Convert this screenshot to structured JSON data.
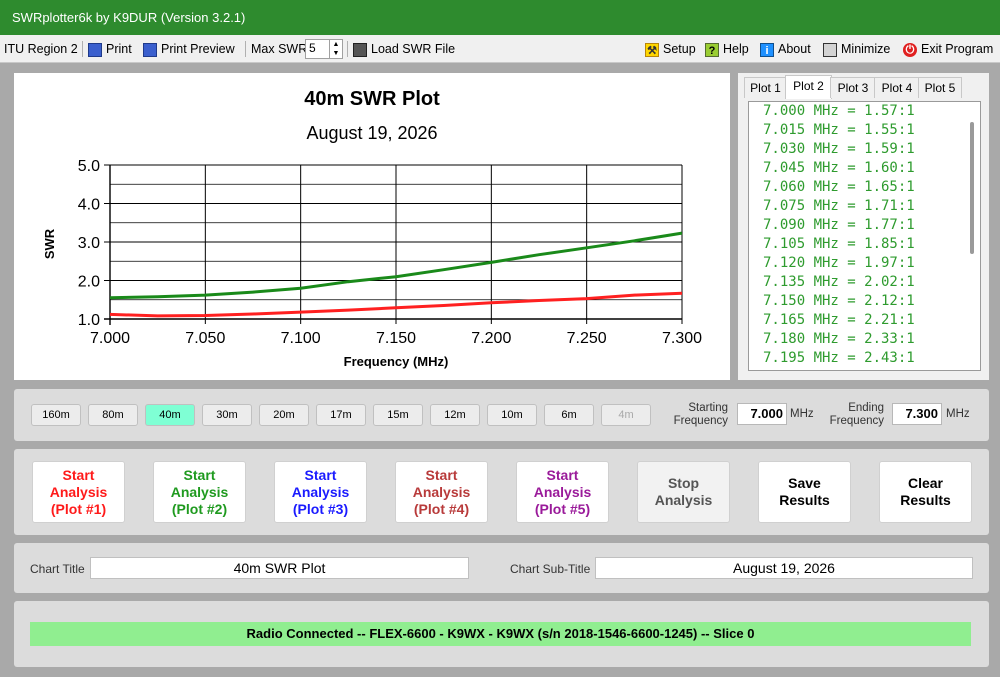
{
  "window": {
    "title": "SWRplotter6k by K9DUR (Version 3.2.1)"
  },
  "menu": {
    "region": "ITU Region 2",
    "print": "Print",
    "print_preview": "Print Preview",
    "max_swr_label": "Max SWR",
    "max_swr_value": "5",
    "load_swr_file": "Load SWR File",
    "setup": "Setup",
    "help": "Help",
    "about": "About",
    "minimize": "Minimize",
    "exit": "Exit Program"
  },
  "chart_data": {
    "type": "line",
    "title": "40m SWR Plot",
    "subtitle": "August 19, 2026",
    "xlabel": "Frequency (MHz)",
    "ylabel": "SWR",
    "xlim": [
      7.0,
      7.3
    ],
    "ylim": [
      1.0,
      5.0
    ],
    "x_ticks": [
      "7.000",
      "7.050",
      "7.100",
      "7.150",
      "7.200",
      "7.250",
      "7.300"
    ],
    "y_ticks": [
      "1.0",
      "2.0",
      "3.0",
      "4.0",
      "5.0"
    ],
    "grid": true,
    "series": [
      {
        "color": "#1a8a1a",
        "x": [
          7.0,
          7.025,
          7.05,
          7.075,
          7.1,
          7.125,
          7.15,
          7.175,
          7.2,
          7.225,
          7.25,
          7.275,
          7.3
        ],
        "y": [
          1.55,
          1.58,
          1.62,
          1.7,
          1.8,
          1.97,
          2.1,
          2.28,
          2.47,
          2.67,
          2.85,
          3.03,
          3.23
        ]
      },
      {
        "color": "#ff2020",
        "x": [
          7.0,
          7.025,
          7.05,
          7.075,
          7.1,
          7.125,
          7.15,
          7.175,
          7.2,
          7.225,
          7.25,
          7.275,
          7.3
        ],
        "y": [
          1.12,
          1.08,
          1.09,
          1.13,
          1.18,
          1.23,
          1.29,
          1.35,
          1.42,
          1.48,
          1.53,
          1.62,
          1.67
        ]
      }
    ]
  },
  "plot_tabs": [
    "Plot 1",
    "Plot 2",
    "Plot 3",
    "Plot 4",
    "Plot 5"
  ],
  "plot_list": [
    "7.000 MHz = 1.57:1",
    "7.015 MHz = 1.55:1",
    "7.030 MHz = 1.59:1",
    "7.045 MHz = 1.60:1",
    "7.060 MHz = 1.65:1",
    "7.075 MHz = 1.71:1",
    "7.090 MHz = 1.77:1",
    "7.105 MHz = 1.85:1",
    "7.120 MHz = 1.97:1",
    "7.135 MHz = 2.02:1",
    "7.150 MHz = 2.12:1",
    "7.165 MHz = 2.21:1",
    "7.180 MHz = 2.33:1",
    "7.195 MHz = 2.43:1"
  ],
  "bands": [
    "160m",
    "80m",
    "40m",
    "30m",
    "20m",
    "17m",
    "15m",
    "12m",
    "10m",
    "6m",
    "4m"
  ],
  "frequency": {
    "starting_label_1": "Starting",
    "starting_label_2": "Frequency",
    "starting_value": "7.000",
    "ending_label_1": "Ending",
    "ending_label_2": "Frequency",
    "ending_value": "7.300",
    "unit": "MHz"
  },
  "action_buttons": [
    {
      "lines": [
        "Start",
        "Analysis",
        "(Plot #1)"
      ],
      "color": "#ff1a1a"
    },
    {
      "lines": [
        "Start",
        "Analysis",
        "(Plot #2)"
      ],
      "color": "#1f9a1f"
    },
    {
      "lines": [
        "Start",
        "Analysis",
        "(Plot #3)"
      ],
      "color": "#1a1aff"
    },
    {
      "lines": [
        "Start",
        "Analysis",
        "(Plot #4)"
      ],
      "color": "#b83a3a"
    },
    {
      "lines": [
        "Start",
        "Analysis",
        "(Plot #5)"
      ],
      "color": "#9a1a9a"
    },
    {
      "lines": [
        "Stop",
        "Analysis"
      ],
      "color": "#555555"
    },
    {
      "lines": [
        "Save",
        "Results"
      ],
      "color": "#000000"
    },
    {
      "lines": [
        "Clear",
        "Results"
      ],
      "color": "#000000"
    }
  ],
  "titles": {
    "chart_title_label": "Chart Title",
    "chart_title_value": "40m SWR Plot",
    "chart_subtitle_label": "Chart Sub-Title",
    "chart_subtitle_value": "August 19, 2026"
  },
  "status": {
    "text": "Radio Connected -- FLEX-6600 - K9WX - K9WX  (s/n 2018-1546-6600-1245) -- Slice 0"
  }
}
